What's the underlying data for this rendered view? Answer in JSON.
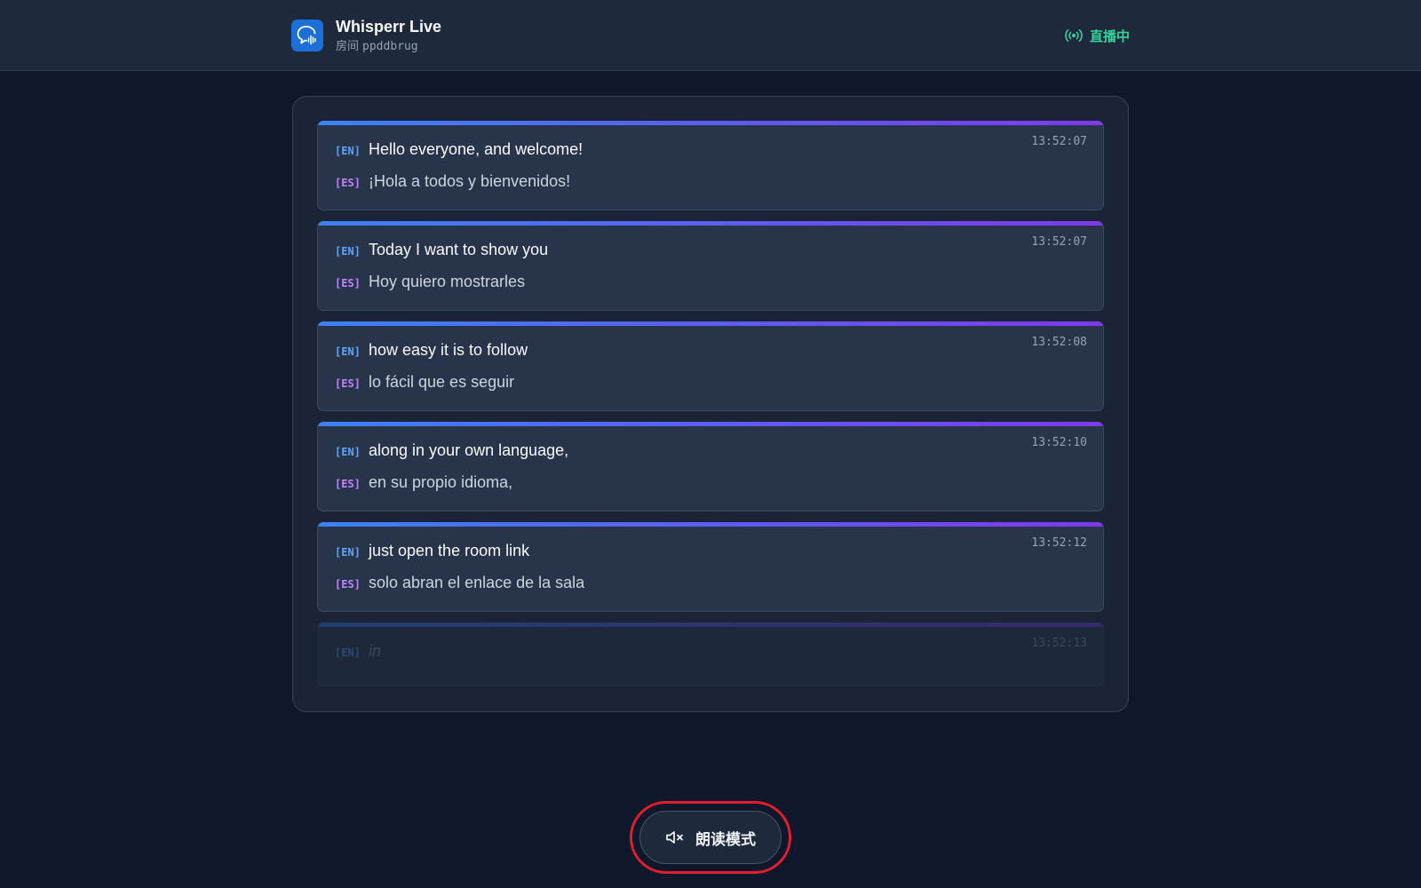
{
  "header": {
    "app_title": "Whisperr Live",
    "room_label": "房间",
    "room_id": "ppddbrug",
    "live_status": "直播中",
    "logo_icon": "chat-bubble-waveform-icon",
    "live_icon": "broadcast-icon"
  },
  "feed": {
    "items": [
      {
        "time": "13:52:07",
        "en_tag": "[EN]",
        "en": "Hello everyone, and welcome!",
        "es_tag": "[ES]",
        "es": "¡Hola a todos y bienvenidos!"
      },
      {
        "time": "13:52:07",
        "en_tag": "[EN]",
        "en": "Today I want to show you",
        "es_tag": "[ES]",
        "es": "Hoy quiero mostrarles"
      },
      {
        "time": "13:52:08",
        "en_tag": "[EN]",
        "en": "how easy it is to follow",
        "es_tag": "[ES]",
        "es": "lo fácil que es seguir"
      },
      {
        "time": "13:52:10",
        "en_tag": "[EN]",
        "en": "along in your own language,",
        "es_tag": "[ES]",
        "es": "en su propio idioma,"
      },
      {
        "time": "13:52:12",
        "en_tag": "[EN]",
        "en": "just open the room link",
        "es_tag": "[ES]",
        "es": "solo abran el enlace de la sala"
      }
    ],
    "pending": {
      "time": "13:52:13",
      "en_tag": "[EN]",
      "en": "in"
    }
  },
  "read_mode": {
    "label": "朗读模式",
    "icon": "speaker-muted-icon"
  },
  "colors": {
    "background": "#0f172a",
    "header": "#1e293b",
    "live_green": "#34d399",
    "en_tag": "#60a5fa",
    "es_tag": "#c084fc",
    "accent_gradient_start": "#3b82f6",
    "accent_gradient_end": "#7c3aed",
    "highlight_ring": "#e11d2f"
  }
}
